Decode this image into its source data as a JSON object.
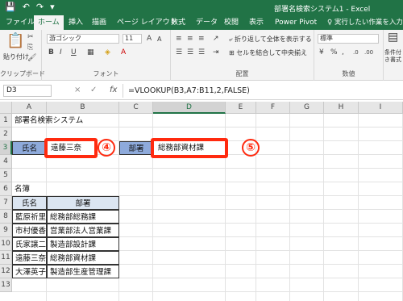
{
  "titlebar": {
    "title": "部署名検索システム1 - Excel",
    "qat": [
      "💾",
      "↶",
      "↷",
      "▾"
    ]
  },
  "tabs": [
    "ファイル",
    "ホーム",
    "挿入",
    "描画",
    "ページ レイアウト",
    "数式",
    "データ",
    "校閲",
    "表示",
    "Power Pivot"
  ],
  "active_tab": "ホーム",
  "tell_me": "♀ 実行したい作業を入力してくださ",
  "ribbon": {
    "clipboard": {
      "paste_label": "貼り付け",
      "group_label": "クリップボード"
    },
    "font": {
      "font_name": "游ゴシック",
      "font_size": "11",
      "group_label": "フォント",
      "bold": "B",
      "italic": "I",
      "underline": "U"
    },
    "alignment": {
      "wrap_text": "折り返して全体を表示する",
      "merge_center": "セルを結合して中央揃え",
      "group_label": "配置"
    },
    "number": {
      "format": "標準",
      "group_label": "数値"
    },
    "styles": {
      "conditional": "条件付き書式"
    }
  },
  "formula_bar": {
    "name_box": "D3",
    "cancel": "×",
    "enter": "✓",
    "fx": "fx",
    "formula": "=VLOOKUP(B3,A7:B11,2,FALSE)"
  },
  "grid": {
    "columns": [
      "A",
      "B",
      "C",
      "D",
      "E",
      "F",
      "G",
      "H",
      "I"
    ],
    "rows": [
      "1",
      "2",
      "3",
      "4",
      "5",
      "6",
      "7",
      "8",
      "9",
      "10",
      "11",
      "12",
      "13"
    ],
    "selected_column": "D",
    "selected_row": "3",
    "cells": {
      "A1": "部署名検索システム",
      "A3": "氏名",
      "B3": "遠藤三奈",
      "C3": "部署",
      "D3": "総務部資材課",
      "A6": "名簿",
      "A7": "氏名",
      "B7": "部署",
      "table": [
        [
          "藍原祈里",
          "総務部総務課"
        ],
        [
          "市村優香",
          "営業部法人営業課"
        ],
        [
          "氏家譲二",
          "製造部設計課"
        ],
        [
          "遠藤三奈",
          "総務部資材課"
        ],
        [
          "大澤英子",
          "製造部生産管理課"
        ]
      ]
    }
  },
  "annotations": {
    "marker_b3": "④",
    "marker_d3": "⑤",
    "color": "#ff2a0f"
  }
}
